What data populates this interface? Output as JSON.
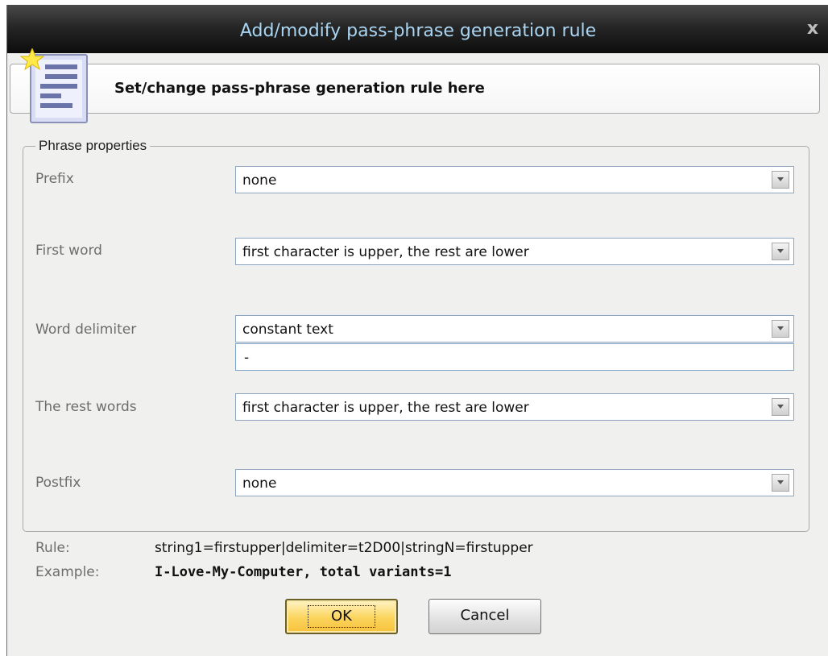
{
  "window": {
    "title": "Add/modify pass-phrase generation rule",
    "close_glyph": "x"
  },
  "banner": {
    "text": "Set/change pass-phrase generation rule here",
    "icon": "rule-document-icon"
  },
  "group": {
    "legend": "Phrase properties",
    "fields": {
      "prefix": {
        "label": "Prefix",
        "value": "none"
      },
      "first_word": {
        "label": "First word",
        "value": "first character is upper, the rest are lower"
      },
      "word_delimiter": {
        "label": "Word delimiter",
        "value": "constant text",
        "text_value": "-"
      },
      "rest_words": {
        "label": "The rest words",
        "value": "first character is upper, the rest are lower"
      },
      "postfix": {
        "label": "Postfix",
        "value": "none"
      }
    }
  },
  "info": {
    "rule_label": "Rule:",
    "rule_value": "string1=firstupper|delimiter=t2D00|stringN=firstupper",
    "example_label": "Example:",
    "example_value": "I-Love-My-Computer, total variants=1"
  },
  "buttons": {
    "ok": "OK",
    "cancel": "Cancel"
  },
  "colors": {
    "title_text": "#a9d5f2",
    "ok_button": "#fbd45c",
    "field_border": "#8fa6c2"
  }
}
